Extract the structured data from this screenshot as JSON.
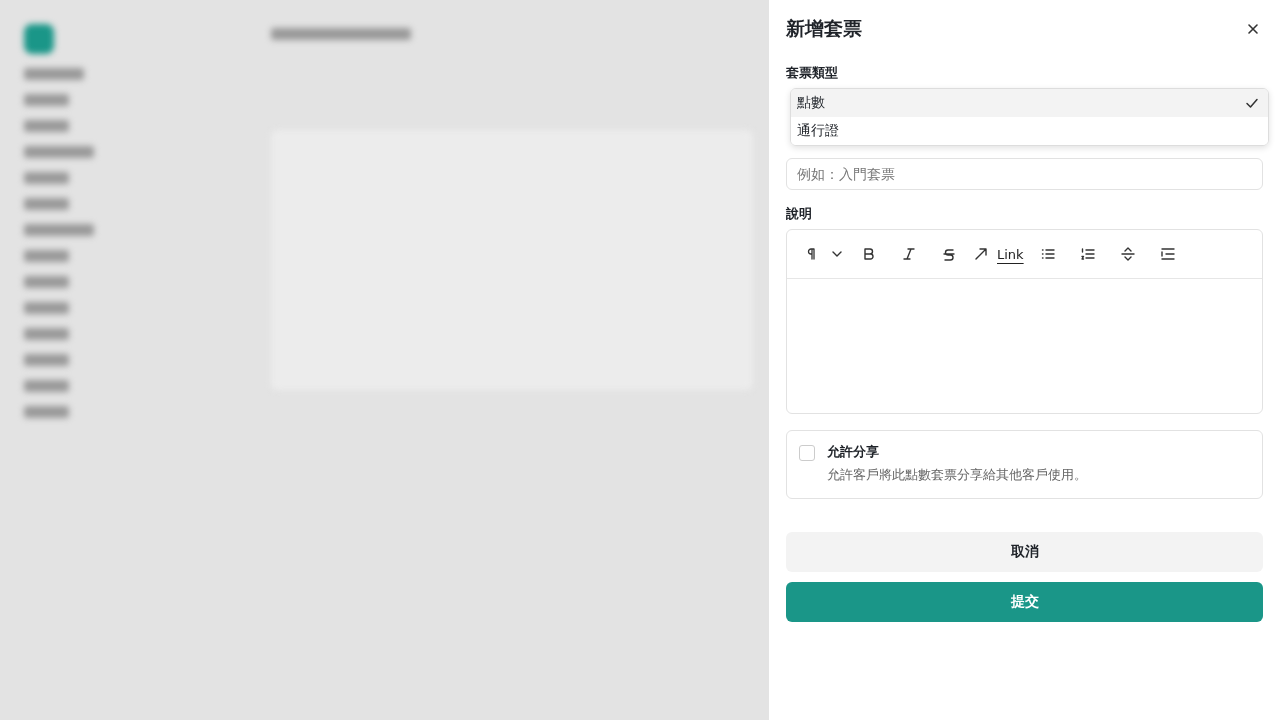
{
  "drawer": {
    "title": "新增套票",
    "type_label": "套票類型",
    "type_options": [
      {
        "label": "點數",
        "selected": true
      },
      {
        "label": "通行證",
        "selected": false
      }
    ],
    "name_field": {
      "placeholder": "例如：入門套票"
    },
    "description_label": "說明",
    "editor_toolbar": [
      {
        "kind": "paragraph"
      },
      {
        "kind": "bold"
      },
      {
        "kind": "italic"
      },
      {
        "kind": "strike"
      },
      {
        "kind": "link",
        "label": "Link"
      },
      {
        "kind": "bullet-list"
      },
      {
        "kind": "ordered-list"
      },
      {
        "kind": "collapse"
      },
      {
        "kind": "indent"
      }
    ],
    "share_option": {
      "label": "允許分享",
      "description": "允許客戶將此點數套票分享給其他客戶使用。",
      "checked": false
    },
    "buttons": [
      {
        "label": "取消",
        "kind": "secondary"
      },
      {
        "label": "提交",
        "kind": "primary"
      }
    ]
  }
}
